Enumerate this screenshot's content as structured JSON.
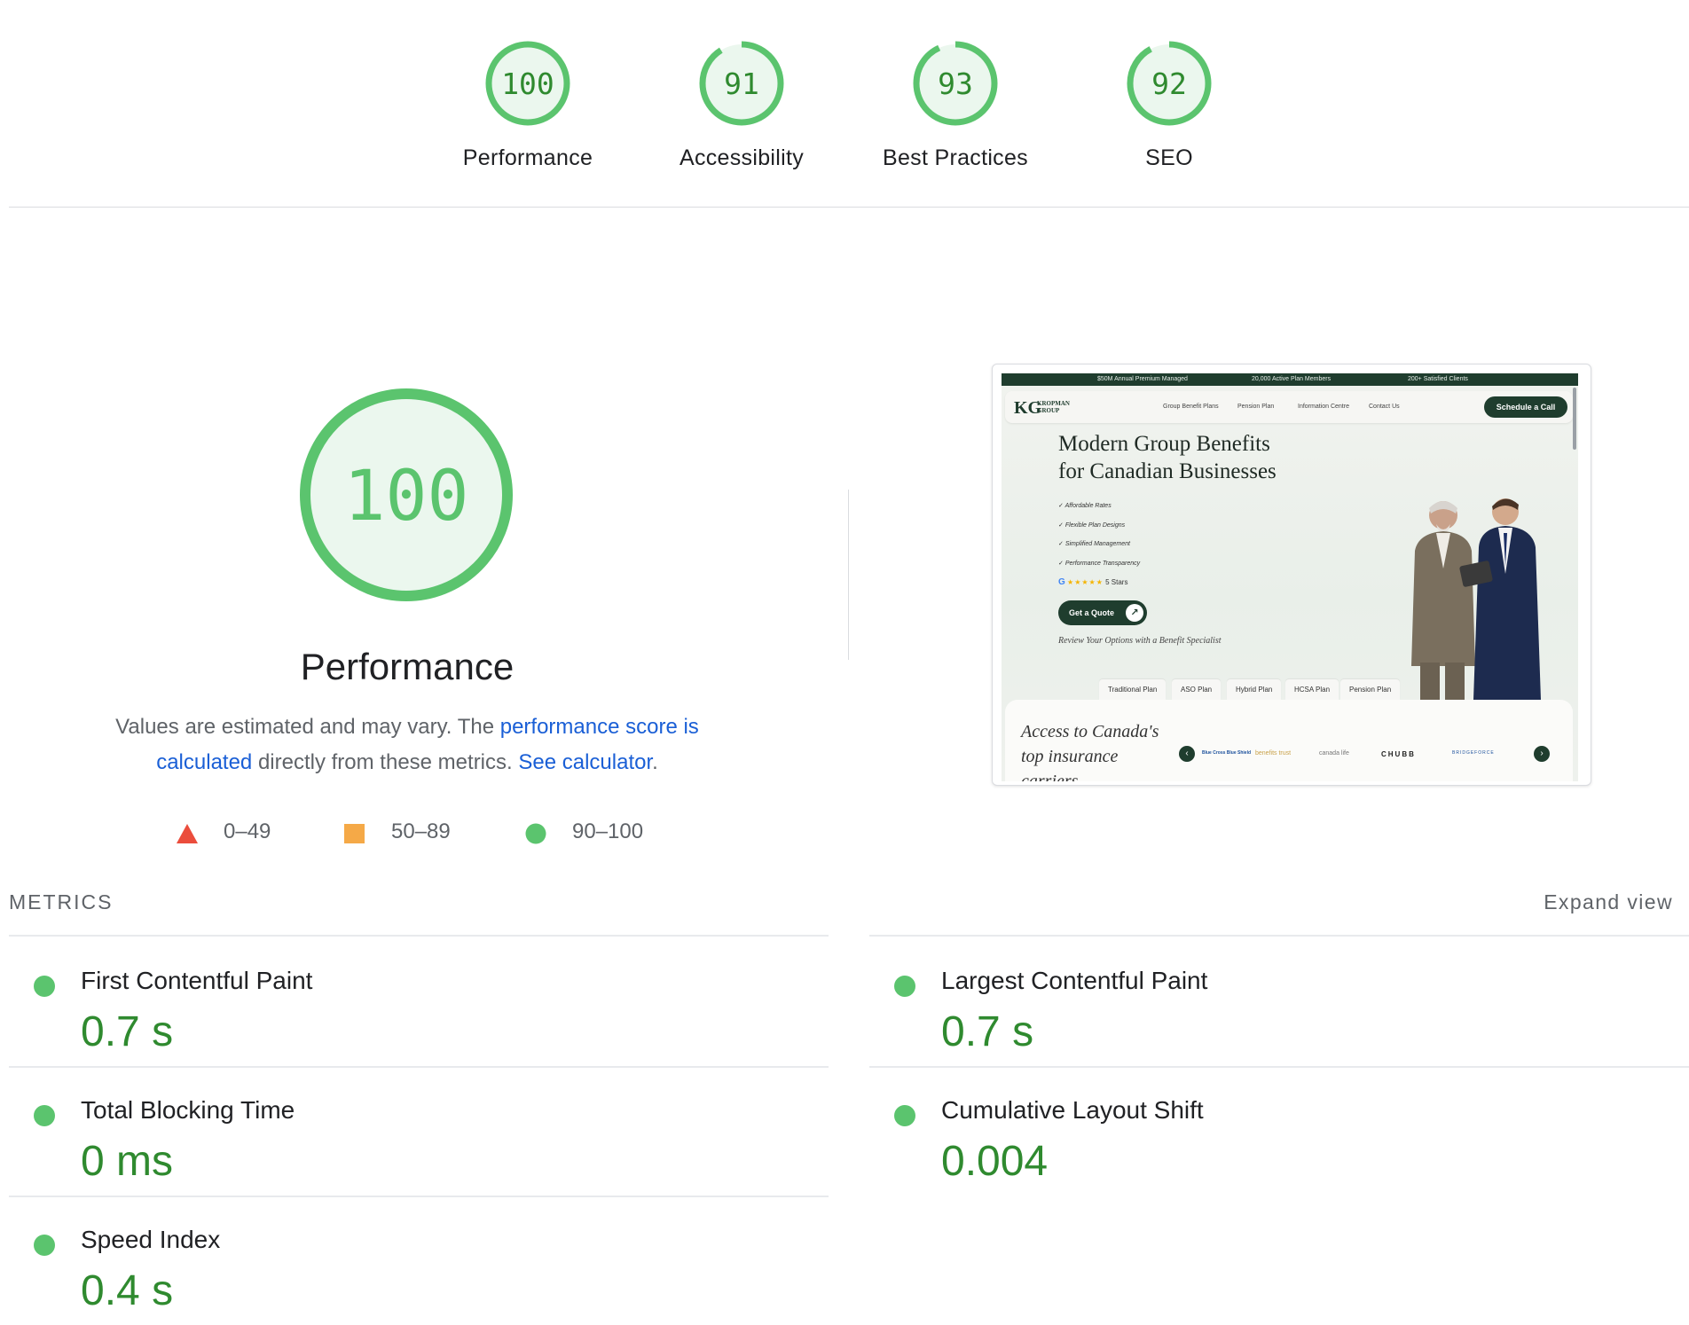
{
  "gauges": [
    {
      "score": "100",
      "value": 100,
      "label": "Performance"
    },
    {
      "score": "91",
      "value": 91,
      "label": "Accessibility"
    },
    {
      "score": "93",
      "value": 93,
      "label": "Best Practices"
    },
    {
      "score": "92",
      "value": 92,
      "label": "SEO"
    }
  ],
  "performance": {
    "score": "100",
    "value": 100,
    "title": "Performance",
    "desc_before": "Values are estimated and may vary. The ",
    "desc_link1": "performance score is calculated",
    "desc_middle": " directly from these metrics. ",
    "desc_link2": "See calculator",
    "desc_after": "."
  },
  "legend": [
    {
      "range": "0–49",
      "shape": "triangle",
      "color": "#eb4d3c"
    },
    {
      "range": "50–89",
      "shape": "square",
      "color": "#f5a947"
    },
    {
      "range": "90–100",
      "shape": "circle",
      "color": "#5bc46e"
    }
  ],
  "colors": {
    "pass": "#5bc46e",
    "pass_text": "#2f8a2f",
    "gauge_fill": "#ebf7ee",
    "link": "#1a5fd6"
  },
  "screenshot": {
    "topbar": [
      "$50M Annual Premium Managed",
      "20,000 Active Plan Members",
      "200+ Satisfied Clients"
    ],
    "logo_mark": "KG",
    "logo_text_1": "KROPMAN",
    "logo_text_2": "GROUP",
    "nav_links": [
      "Group Benefit Plans",
      "Pension Plan",
      "Information Centre",
      "Contact Us"
    ],
    "cta": "Schedule a Call",
    "hero_line1": "Modern Group Benefits",
    "hero_line2": "for Canadian Businesses",
    "checks": [
      "Affordable Rates",
      "Flexible Plan Designs",
      "Simplified Management",
      "Performance Transparency"
    ],
    "rating_g": "G",
    "rating_stars": "★★★★★",
    "rating_text": "5 Stars",
    "quote_btn": "Get a Quote",
    "review_text": "Review Your Options with a Benefit Specialist",
    "tabs": [
      "Traditional Plan",
      "ASO Plan",
      "Hybrid Plan",
      "HCSA Plan",
      "Pension Plan"
    ],
    "access_line1": "Access to Canada's",
    "access_line2": "top insurance",
    "access_line3": "carriers",
    "carriers": [
      "Blue Cross Blue Shield",
      "benefits trust",
      "canada life",
      "CHUBB",
      "BRIDGEFORCE"
    ]
  },
  "metrics": {
    "header": "METRICS",
    "expand": "Expand view",
    "items": [
      {
        "title": "First Contentful Paint",
        "value": "0.7 s"
      },
      {
        "title": "Largest Contentful Paint",
        "value": "0.7 s"
      },
      {
        "title": "Total Blocking Time",
        "value": "0 ms"
      },
      {
        "title": "Cumulative Layout Shift",
        "value": "0.004"
      },
      {
        "title": "Speed Index",
        "value": "0.4 s"
      }
    ]
  }
}
